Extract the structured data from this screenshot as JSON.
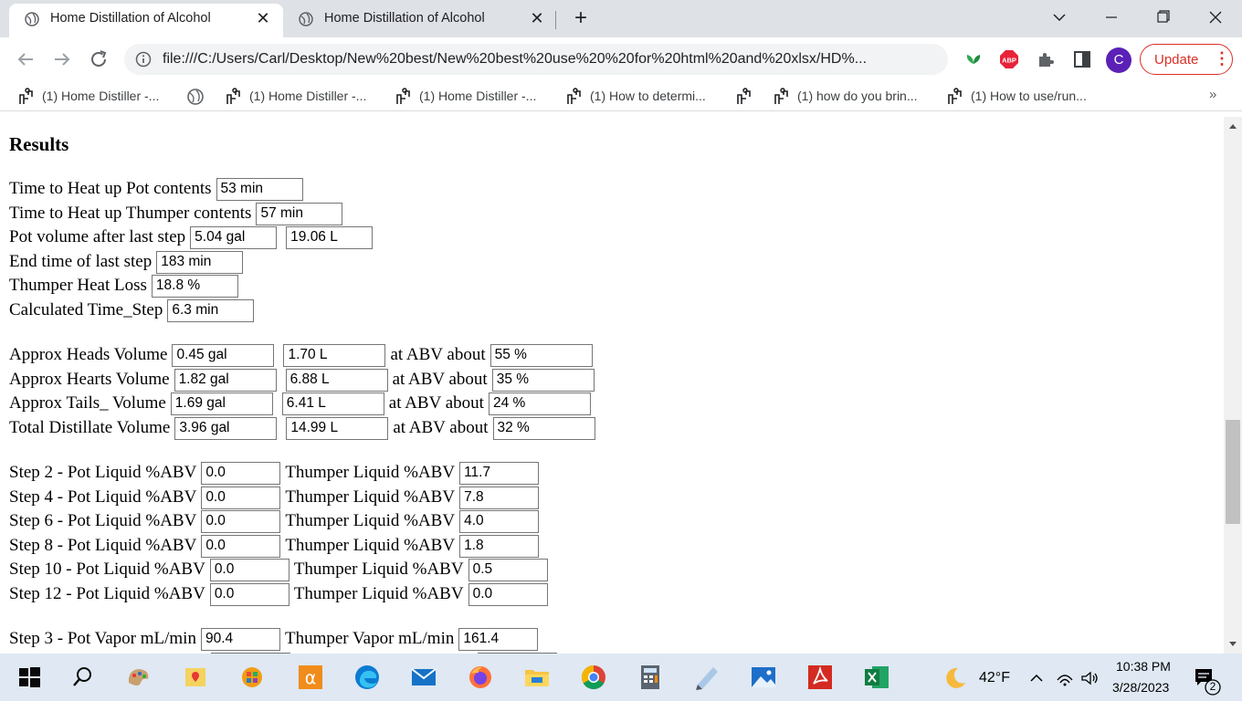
{
  "browser": {
    "tabs": [
      {
        "title": "Home Distillation of Alcohol",
        "close": "✕"
      },
      {
        "title": "Home Distillation of Alcohol",
        "close": "✕"
      }
    ],
    "new_tab": "+",
    "address": "file:///C:/Users/Carl/Desktop/New%20best/New%20best%20use%20%20for%20html%20and%20xlsx/HD%...",
    "profile_initial": "C",
    "update_label": "Update",
    "menu_dots": "⋮",
    "abp_label": "ABP",
    "bookmarks": [
      {
        "label": "(1) Home Distiller -...",
        "icon": "distiller-icon"
      },
      {
        "label": "",
        "icon": "globe-icon"
      },
      {
        "label": "(1) Home Distiller -...",
        "icon": "distiller-icon"
      },
      {
        "label": "(1) Home Distiller -...",
        "icon": "distiller-icon"
      },
      {
        "label": "(1) How to determi...",
        "icon": "distiller-icon"
      },
      {
        "label": "",
        "icon": "distiller-icon"
      },
      {
        "label": "(1) how do you brin...",
        "icon": "distiller-icon"
      },
      {
        "label": "(1) How to use/run...",
        "icon": "distiller-icon"
      }
    ],
    "bookmarks_more": "»"
  },
  "page": {
    "heading": "Results",
    "summary": [
      {
        "label": "Time to Heat up Pot contents",
        "values": [
          "53 min"
        ]
      },
      {
        "label": "Time to Heat up Thumper contents",
        "values": [
          "57 min"
        ]
      },
      {
        "label": "Pot volume after last step",
        "values": [
          "5.04 gal",
          "19.06 L"
        ]
      },
      {
        "label": "End time of last step",
        "values": [
          "183 min"
        ]
      },
      {
        "label": "Thumper Heat Loss",
        "values": [
          "18.8 %"
        ]
      },
      {
        "label": "Calculated Time_Step",
        "values": [
          "6.3 min"
        ]
      }
    ],
    "abv_label": "at ABV about",
    "volumes": [
      {
        "label": "Approx Heads Volume",
        "gal": "0.45 gal",
        "liters": "1.70 L",
        "abv": "55 %"
      },
      {
        "label": "Approx Hearts Volume",
        "gal": "1.82 gal",
        "liters": "6.88 L",
        "abv": "35 %"
      },
      {
        "label": "Approx Tails_ Volume",
        "gal": "1.69 gal",
        "liters": "6.41 L",
        "abv": "24 %"
      },
      {
        "label": "Total Distillate Volume",
        "gal": "3.96 gal",
        "liters": "14.99 L",
        "abv": "32 %"
      }
    ],
    "thumper_abv_label": "Thumper Liquid %ABV",
    "liquid_steps": [
      {
        "label": "Step 2 - Pot Liquid %ABV",
        "pot": "0.0",
        "thumper": "11.7"
      },
      {
        "label": "Step 4 - Pot Liquid %ABV",
        "pot": "0.0",
        "thumper": "7.8"
      },
      {
        "label": "Step 6 - Pot Liquid %ABV",
        "pot": "0.0",
        "thumper": "4.0"
      },
      {
        "label": "Step 8 - Pot Liquid %ABV",
        "pot": "0.0",
        "thumper": "1.8"
      },
      {
        "label": "Step 10 - Pot Liquid %ABV",
        "pot": "0.0",
        "thumper": "0.5"
      },
      {
        "label": "Step 12 - Pot Liquid %ABV",
        "pot": "0.0",
        "thumper": "0.0"
      }
    ],
    "vapor_steps": [
      {
        "label": "Step 3 - Pot Vapor mL/min",
        "pot": "90.4",
        "thumper_label": "Thumper Vapor mL/min",
        "thumper": "161.4"
      }
    ]
  },
  "taskbar": {
    "temperature": "42°F",
    "time": "10:38 PM",
    "date": "3/28/2023",
    "notification_count": "2",
    "apps": [
      "start-icon",
      "search-icon",
      "paint-icon",
      "maps-icon",
      "games-icon",
      "alpha-icon",
      "edge-icon",
      "mail-icon",
      "firefox-icon",
      "file-explorer-icon",
      "chrome-icon",
      "calculator-icon",
      "notepad-icon",
      "photos-icon",
      "acrobat-icon",
      "excel-icon"
    ]
  },
  "colors": {
    "tabstrip_bg": "#dee1e6",
    "update_red": "#d93025",
    "profile_purple": "#5b21b6",
    "taskbar_bg": "#dfe8f3"
  }
}
